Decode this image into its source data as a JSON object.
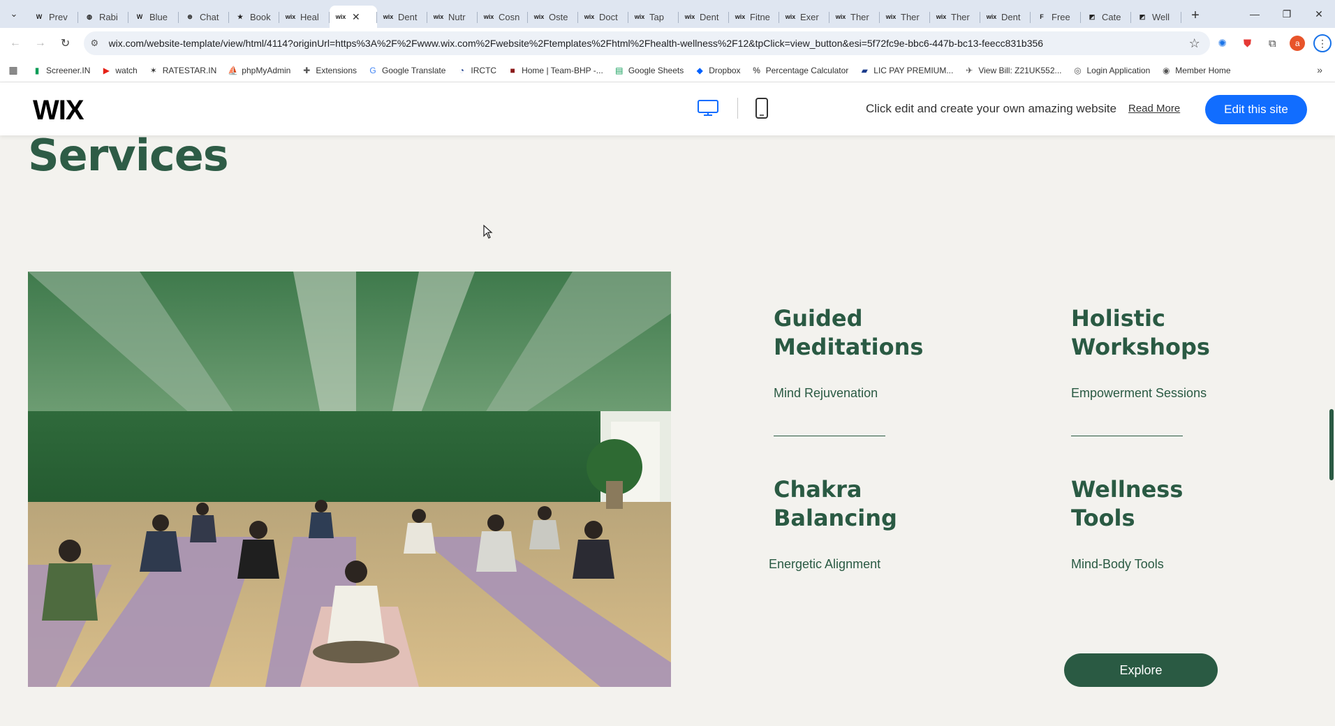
{
  "browser": {
    "tabs": [
      {
        "icon": "W",
        "label": "Prev"
      },
      {
        "icon": "◍",
        "label": "Rabi"
      },
      {
        "icon": "W",
        "label": "Blue"
      },
      {
        "icon": "⊛",
        "label": "Chat"
      },
      {
        "icon": "★",
        "label": "Book"
      },
      {
        "icon": "wix",
        "label": "Heal"
      },
      {
        "icon": "wix",
        "label": ""
      },
      {
        "icon": "wix",
        "label": "Dent"
      },
      {
        "icon": "wix",
        "label": "Nutr"
      },
      {
        "icon": "wix",
        "label": "Cosn"
      },
      {
        "icon": "wix",
        "label": "Oste"
      },
      {
        "icon": "wix",
        "label": "Doct"
      },
      {
        "icon": "wix",
        "label": "Tap"
      },
      {
        "icon": "wix",
        "label": "Dent"
      },
      {
        "icon": "wix",
        "label": "Fitne"
      },
      {
        "icon": "wix",
        "label": "Exer"
      },
      {
        "icon": "wix",
        "label": "Ther"
      },
      {
        "icon": "wix",
        "label": "Ther"
      },
      {
        "icon": "wix",
        "label": "Ther"
      },
      {
        "icon": "wix",
        "label": "Dent"
      },
      {
        "icon": "F",
        "label": "Free"
      },
      {
        "icon": "◩",
        "label": "Cate"
      },
      {
        "icon": "◩",
        "label": "Well"
      }
    ],
    "active_tab_index": 6,
    "url": "wix.com/website-template/view/html/4114?originUrl=https%3A%2F%2Fwww.wix.com%2Fwebsite%2Ftemplates%2Fhtml%2Fhealth-wellness%2F12&tpClick=view_button&esi=5f72fc9e-bbc6-447b-bc13-feecc831b356",
    "profile_initial": "a",
    "bookmarks": [
      {
        "icon": "chart-icon",
        "label": "Screener.IN"
      },
      {
        "icon": "youtube-icon",
        "label": "watch"
      },
      {
        "icon": "ratestar-icon",
        "label": "RATESTAR.IN"
      },
      {
        "icon": "phpmyadmin-icon",
        "label": "phpMyAdmin"
      },
      {
        "icon": "puzzle-icon",
        "label": "Extensions"
      },
      {
        "icon": "translate-icon",
        "label": "Google Translate"
      },
      {
        "icon": "irctc-icon",
        "label": "IRCTC"
      },
      {
        "icon": "teambhp-icon",
        "label": "Home | Team-BHP -..."
      },
      {
        "icon": "sheets-icon",
        "label": "Google Sheets"
      },
      {
        "icon": "dropbox-icon",
        "label": "Dropbox"
      },
      {
        "icon": "percent-icon",
        "label": "Percentage Calculator"
      },
      {
        "icon": "lic-icon",
        "label": "LIC PAY PREMIUM..."
      },
      {
        "icon": "bill-icon",
        "label": "View Bill: Z21UK552..."
      },
      {
        "icon": "login-icon",
        "label": "Login Application"
      },
      {
        "icon": "globe-icon",
        "label": "Member Home"
      }
    ]
  },
  "wix_bar": {
    "logo": "WIX",
    "promo": "Click edit and create your own amazing website",
    "read_more": "Read More",
    "edit_button": "Edit this site"
  },
  "page": {
    "section_title": "Services",
    "services": [
      {
        "title_line1": "Guided",
        "title_line2": "Meditations",
        "subtitle": "Mind Rejuvenation"
      },
      {
        "title_line1": "Holistic",
        "title_line2": "Workshops",
        "subtitle": "Empowerment Sessions"
      },
      {
        "title_line1": "Chakra",
        "title_line2": "Balancing",
        "subtitle": "Energetic Alignment"
      },
      {
        "title_line1": "Wellness",
        "title_line2": "Tools",
        "subtitle": "Mind-Body Tools"
      }
    ],
    "explore_button": "Explore",
    "photo_alt": "group-yoga-class-photo"
  },
  "colors": {
    "brand_green": "#2a5a43",
    "page_bg": "#f3f2ee",
    "wix_blue": "#116dff"
  }
}
